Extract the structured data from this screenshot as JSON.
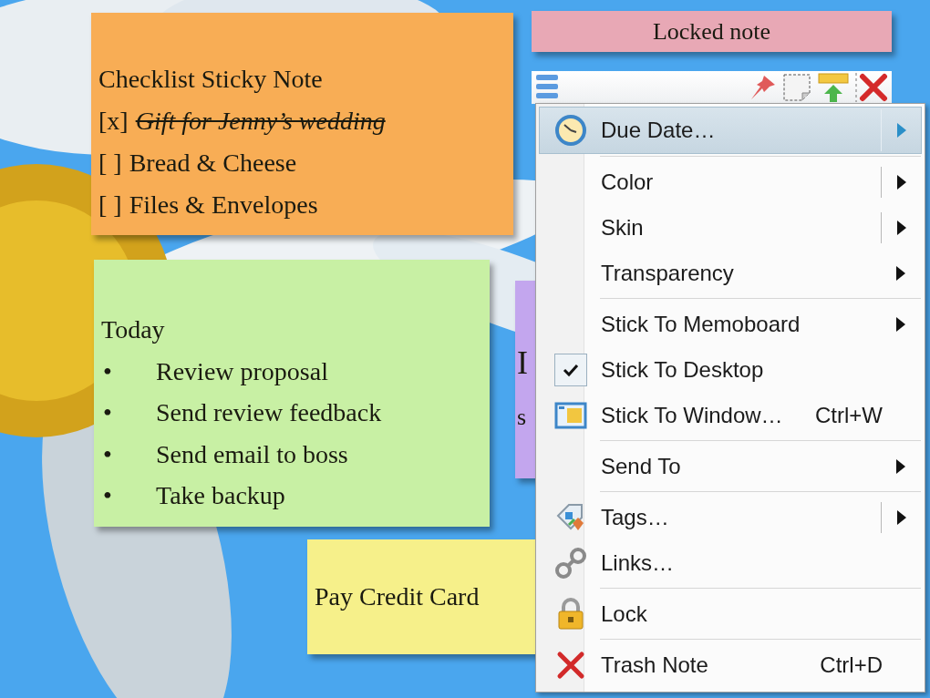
{
  "notes": [
    {
      "kind": "checklist",
      "color": "#f8ad55",
      "title": "Checklist Sticky Note",
      "items": [
        {
          "mark": "[x]",
          "text": "Gift for Jenny’s wedding",
          "checked": true
        },
        {
          "mark": "[ ]",
          "text": "Bread & Cheese",
          "checked": false
        },
        {
          "mark": "[ ]",
          "text": "Files & Envelopes",
          "checked": false
        }
      ]
    },
    {
      "kind": "plain",
      "color": "#e8a8b5",
      "lines": [
        "Locked note"
      ]
    },
    {
      "kind": "bullets",
      "color": "#c8f0a4",
      "title": "Today",
      "bullet": "•",
      "items": [
        "Review proposal",
        "Send review feedback",
        "Send email to boss",
        "Take backup"
      ]
    },
    {
      "kind": "plain",
      "color": "#c3a6ee",
      "lines": [
        "I",
        "s"
      ]
    },
    {
      "kind": "plain",
      "color": "#f6f08a",
      "lines": [
        "Pay Credit Card"
      ]
    }
  ],
  "menu": {
    "items": [
      {
        "label": "Due Date…",
        "submenu": true,
        "split": true,
        "checked": false,
        "selected": true,
        "separator_before": false
      },
      {
        "label": "Color",
        "submenu": true,
        "split": true,
        "checked": false,
        "selected": false,
        "separator_before": true
      },
      {
        "label": "Skin",
        "submenu": true,
        "split": true,
        "checked": false,
        "selected": false,
        "separator_before": false
      },
      {
        "label": "Transparency",
        "submenu": true,
        "split": false,
        "checked": false,
        "selected": false,
        "separator_before": false
      },
      {
        "label": "Stick To Memoboard",
        "submenu": true,
        "split": false,
        "checked": false,
        "selected": false,
        "separator_before": true
      },
      {
        "label": "Stick To Desktop",
        "submenu": false,
        "split": false,
        "checked": true,
        "selected": false,
        "separator_before": false
      },
      {
        "label": "Stick To Window…",
        "shortcut": "Ctrl+W",
        "submenu": false,
        "split": false,
        "checked": false,
        "selected": false,
        "separator_before": false
      },
      {
        "label": "Send To",
        "submenu": true,
        "split": false,
        "checked": false,
        "selected": false,
        "separator_before": true
      },
      {
        "label": "Tags…",
        "submenu": true,
        "split": true,
        "checked": false,
        "selected": false,
        "separator_before": true
      },
      {
        "label": "Links…",
        "submenu": false,
        "split": false,
        "checked": false,
        "selected": false,
        "separator_before": false
      },
      {
        "label": "Lock",
        "submenu": false,
        "split": false,
        "checked": false,
        "selected": false,
        "separator_before": true
      },
      {
        "label": "Trash Note",
        "shortcut": "Ctrl+D",
        "submenu": false,
        "split": false,
        "checked": false,
        "selected": false,
        "separator_before": true
      }
    ]
  }
}
